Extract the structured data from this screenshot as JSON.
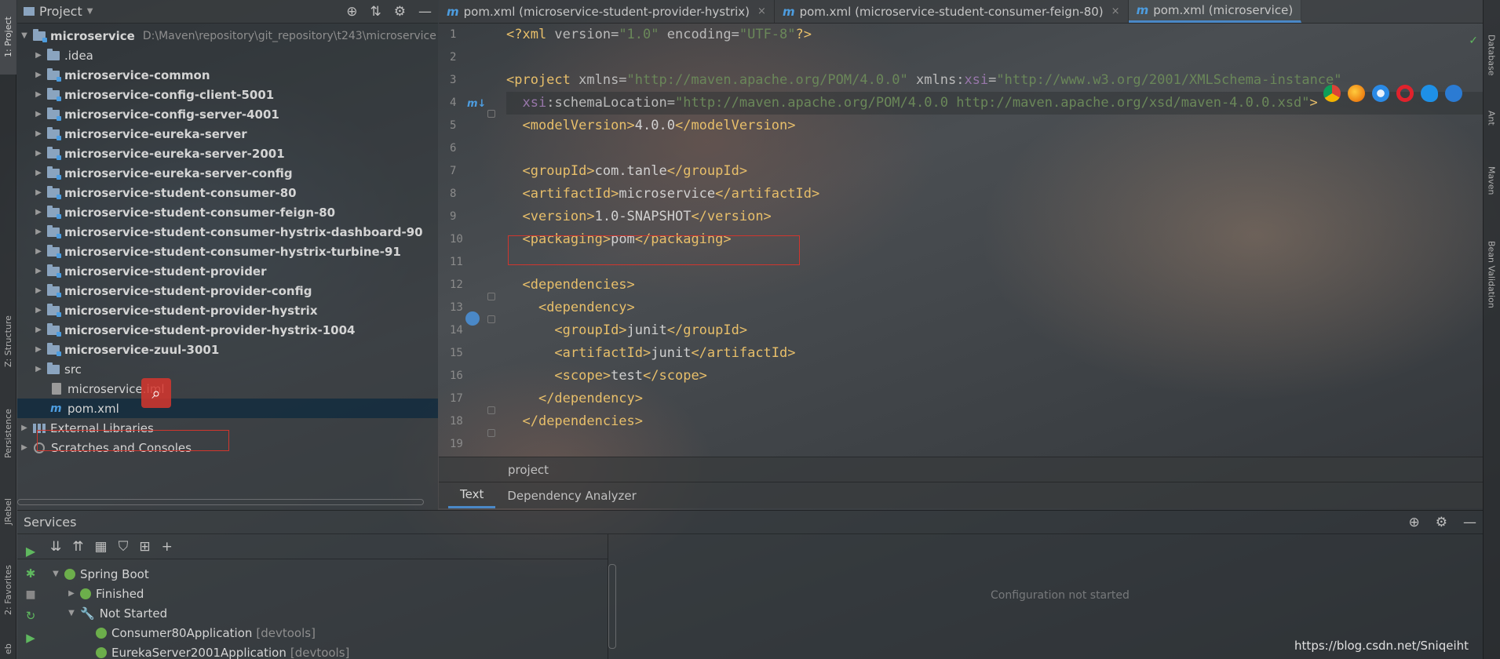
{
  "left_strip": {
    "project_tab": "1: Project",
    "structure_tab": "Z: Structure",
    "persistence_tab": "Persistence",
    "jrebel_tab": "JRebel",
    "favorites_tab": "2: Favorites",
    "web_tab": "eb"
  },
  "right_strip": {
    "database_tab": "Database",
    "ant_tab": "Ant",
    "maven_tab": "Maven",
    "bean_validation_tab": "Bean Validation"
  },
  "project_panel": {
    "title": "Project",
    "root": {
      "name": "microservice",
      "path": "D:\\Maven\\repository\\git_repository\\t243\\microservice"
    },
    "items": [
      {
        "label": ".idea",
        "bold": false,
        "type": "folder"
      },
      {
        "label": "microservice-common",
        "bold": true,
        "type": "module"
      },
      {
        "label": "microservice-config-client-5001",
        "bold": true,
        "type": "module"
      },
      {
        "label": "microservice-config-server-4001",
        "bold": true,
        "type": "module"
      },
      {
        "label": "microservice-eureka-server",
        "bold": true,
        "type": "module"
      },
      {
        "label": "microservice-eureka-server-2001",
        "bold": true,
        "type": "module"
      },
      {
        "label": "microservice-eureka-server-config",
        "bold": true,
        "type": "module"
      },
      {
        "label": "microservice-student-consumer-80",
        "bold": true,
        "type": "module"
      },
      {
        "label": "microservice-student-consumer-feign-80",
        "bold": true,
        "type": "module"
      },
      {
        "label": "microservice-student-consumer-hystrix-dashboard-90",
        "bold": true,
        "type": "module"
      },
      {
        "label": "microservice-student-consumer-hystrix-turbine-91",
        "bold": true,
        "type": "module"
      },
      {
        "label": "microservice-student-provider",
        "bold": true,
        "type": "module"
      },
      {
        "label": "microservice-student-provider-config",
        "bold": true,
        "type": "module"
      },
      {
        "label": "microservice-student-provider-hystrix",
        "bold": true,
        "type": "module"
      },
      {
        "label": "microservice-student-provider-hystrix-1004",
        "bold": true,
        "type": "module"
      },
      {
        "label": "microservice-zuul-3001",
        "bold": true,
        "type": "module"
      },
      {
        "label": "src",
        "bold": false,
        "type": "folder"
      }
    ],
    "iml_file": "microservice.iml",
    "pom_file": "pom.xml",
    "external_libraries": "External Libraries",
    "scratches": "Scratches and Consoles"
  },
  "editor": {
    "tabs": [
      {
        "label": "pom.xml (microservice-student-provider-hystrix)",
        "active": false
      },
      {
        "label": "pom.xml (microservice-student-consumer-feign-80)",
        "active": false
      },
      {
        "label": "pom.xml (microservice)",
        "active": true
      }
    ],
    "line_numbers": [
      "1",
      "2",
      "3",
      "4",
      "5",
      "6",
      "7",
      "8",
      "9",
      "10",
      "11",
      "12",
      "13",
      "14",
      "15",
      "16",
      "17",
      "18",
      "19"
    ],
    "breadcrumb": "project",
    "bottom_tabs": {
      "text": "Text",
      "dependency_analyzer": "Dependency Analyzer"
    }
  },
  "services": {
    "title": "Services",
    "tree": {
      "spring_boot": "Spring Boot",
      "finished": "Finished",
      "not_started": "Not Started",
      "app1": "Consumer80Application",
      "app1_tag": "[devtools]",
      "app2": "EurekaServer2001Application",
      "app2_tag": "[devtools]"
    },
    "empty_message": "Configuration not started"
  },
  "watermark": "https://blog.csdn.net/Sniqeiht",
  "colors": {
    "accent": "#4a88c7",
    "xml_tag": "#e8bf6a",
    "xml_value": "#6a8759",
    "highlight_box": "#d0362e"
  }
}
